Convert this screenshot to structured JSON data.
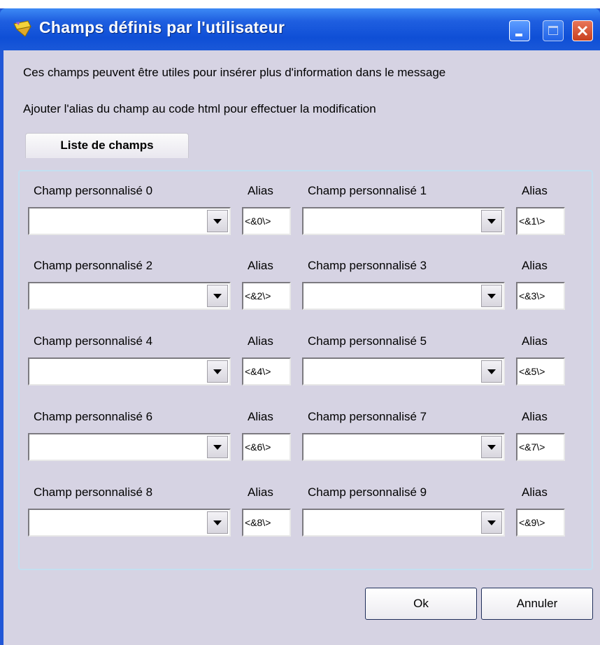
{
  "window": {
    "title": "Champs définis par l'utilisateur",
    "icon": "folder-pencil-icon",
    "colors": {
      "titlebar": "#1f5fe0",
      "background": "#d6d3e3"
    }
  },
  "messages": {
    "line1": "Ces champs peuvent être utiles pour insérer plus d'information dans le message",
    "line2": "Ajouter l'alias du champ au code html pour effectuer la modification"
  },
  "tab": {
    "label": "Liste de champs"
  },
  "fields": [
    {
      "label": "Champ personnalisé 0",
      "alias_label": "Alias",
      "value": "",
      "alias": "<&0\\>"
    },
    {
      "label": "Champ personnalisé 1",
      "alias_label": "Alias",
      "value": "",
      "alias": "<&1\\>"
    },
    {
      "label": "Champ personnalisé 2",
      "alias_label": "Alias",
      "value": "",
      "alias": "<&2\\>"
    },
    {
      "label": "Champ personnalisé 3",
      "alias_label": "Alias",
      "value": "",
      "alias": "<&3\\>"
    },
    {
      "label": "Champ personnalisé 4",
      "alias_label": "Alias",
      "value": "",
      "alias": "<&4\\>"
    },
    {
      "label": "Champ personnalisé 5",
      "alias_label": "Alias",
      "value": "",
      "alias": "<&5\\>"
    },
    {
      "label": "Champ personnalisé 6",
      "alias_label": "Alias",
      "value": "",
      "alias": "<&6\\>"
    },
    {
      "label": "Champ personnalisé 7",
      "alias_label": "Alias",
      "value": "",
      "alias": "<&7\\>"
    },
    {
      "label": "Champ personnalisé 8",
      "alias_label": "Alias",
      "value": "",
      "alias": "<&8\\>"
    },
    {
      "label": "Champ personnalisé 9",
      "alias_label": "Alias",
      "value": "",
      "alias": "<&9\\>"
    }
  ],
  "buttons": {
    "ok": "Ok",
    "cancel": "Annuler"
  }
}
